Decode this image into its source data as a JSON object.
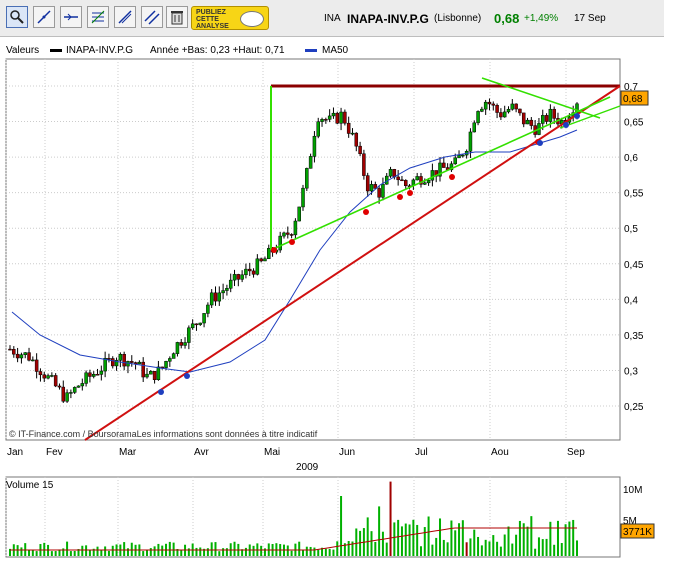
{
  "toolbar": {
    "tools": [
      "zoom-tool-icon",
      "line-tool-icon",
      "horizontal-line-tool-icon",
      "fibonacci-tool-icon",
      "channel-tool-icon",
      "parallel-lines-tool-icon",
      "trash-icon"
    ],
    "ad_text": "PUBLIEZ CETTE ANALYSE"
  },
  "quote": {
    "ticker": "INA",
    "name": "INAPA-INV.P.G",
    "market": "(Lisbonne)",
    "price": "0,68",
    "change": "+1,49%",
    "date": "17 Sep"
  },
  "legend": {
    "valeurs": "Valeurs",
    "series_name": "INAPA-INV.P.G",
    "range": "Année +Bas: 0,23 +Haut: 0,71",
    "ma_name": "MA50"
  },
  "volume_label": "Volume 15",
  "credit": "© IT-Finance.com / BoursoramaLes informations sont données à titre indicatif",
  "colors": {
    "up": "#00a000",
    "down": "#a00000",
    "ma": "#1f3fbf",
    "resistance": "#8b0000",
    "support": "#e00000",
    "trend": "#33e000",
    "price_tag": "#ffa500",
    "volume": "#00b000",
    "volume_ma": "#b00000"
  },
  "chart_data": {
    "type": "candlestick",
    "x_axis": {
      "months": [
        "Jan",
        "Fev",
        "Mar",
        "Avr",
        "Mai",
        "Jun",
        "Jul",
        "Aou",
        "Sep"
      ],
      "year": "2009"
    },
    "price_axis": {
      "ticks": [
        "0,25",
        "0,3",
        "0,35",
        "0,4",
        "0,45",
        "0,5",
        "0,55",
        "0,6",
        "0,65",
        "0,7"
      ],
      "ylim": [
        0.2,
        0.72
      ]
    },
    "last_price": "0,68",
    "volume_axis": {
      "ticks": [
        "10M",
        "5M"
      ],
      "last_volume": "3771K"
    },
    "annotations": [
      "resistance 0,70",
      "rising support line",
      "rising trendline",
      "MA50"
    ]
  }
}
